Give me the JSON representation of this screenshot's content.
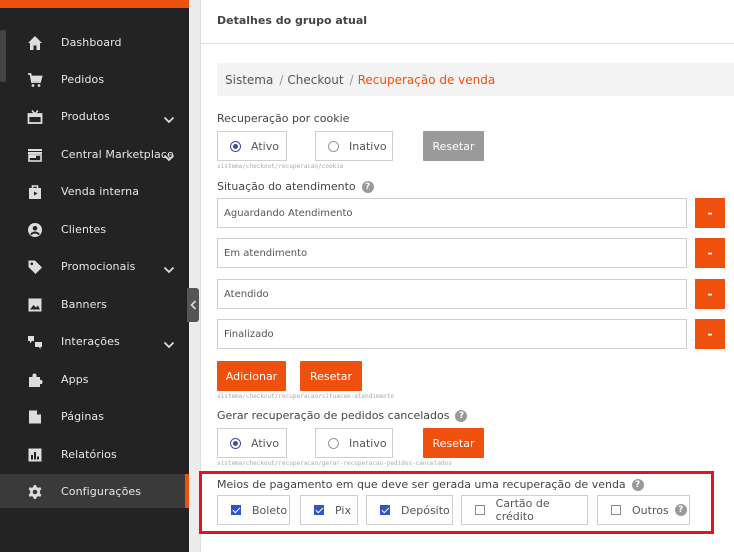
{
  "sidebar": {
    "items": [
      {
        "label": "Dashboard",
        "icon": "home-icon"
      },
      {
        "label": "Pedidos",
        "icon": "cart-icon"
      },
      {
        "label": "Produtos",
        "icon": "gift-icon",
        "expandable": true
      },
      {
        "label": "Central Marketplace",
        "icon": "store-icon",
        "expandable": true
      },
      {
        "label": "Venda interna",
        "icon": "bag-icon"
      },
      {
        "label": "Clientes",
        "icon": "user-icon"
      },
      {
        "label": "Promocionais",
        "icon": "tag-icon",
        "expandable": true
      },
      {
        "label": "Banners",
        "icon": "image-icon"
      },
      {
        "label": "Interações",
        "icon": "chat-icon",
        "expandable": true
      },
      {
        "label": "Apps",
        "icon": "puzzle-icon"
      },
      {
        "label": "Páginas",
        "icon": "file-icon"
      },
      {
        "label": "Relatórios",
        "icon": "report-icon"
      },
      {
        "label": "Configurações",
        "icon": "gear-icon",
        "active": true
      }
    ]
  },
  "panel": {
    "title": "Detalhes do grupo atual",
    "breadcrumb": [
      "Sistema",
      "Checkout",
      "Recuperação de venda"
    ]
  },
  "cookie": {
    "label": "Recuperação por cookie",
    "option_active": "Ativo",
    "option_inactive": "Inativo",
    "selected": "Ativo",
    "reset": "Resetar",
    "path": "sistema/checkout/recuperacao/cookie"
  },
  "situacao": {
    "label": "Situação do atendimento",
    "fields": [
      "Aguardando Atendimento",
      "Em atendimento",
      "Atendido",
      "Finalizado"
    ],
    "remove": "-",
    "add": "Adicionar",
    "reset": "Resetar",
    "path": "sistema/checkout/recuperacao/situacao-atendimento"
  },
  "cancelados": {
    "label": "Gerar recuperação de pedidos cancelados",
    "option_active": "Ativo",
    "option_inactive": "Inativo",
    "selected": "Ativo",
    "reset": "Resetar",
    "path": "sistema/checkout/recuperacao/gerar-recuperacao-pedidos-cancelados"
  },
  "pagamento": {
    "label": "Meios de pagamento em que deve ser gerada uma recuperação de venda",
    "options": [
      {
        "label": "Boleto",
        "checked": true
      },
      {
        "label": "Pix",
        "checked": true
      },
      {
        "label": "Depósito",
        "checked": true
      },
      {
        "label": "Cartão de crédito",
        "checked": false
      },
      {
        "label": "Outros",
        "checked": false
      }
    ]
  },
  "colors": {
    "accent": "#f0500e",
    "sidebar": "#232323",
    "highlight": "#e0131f",
    "check": "#2e56c8"
  }
}
